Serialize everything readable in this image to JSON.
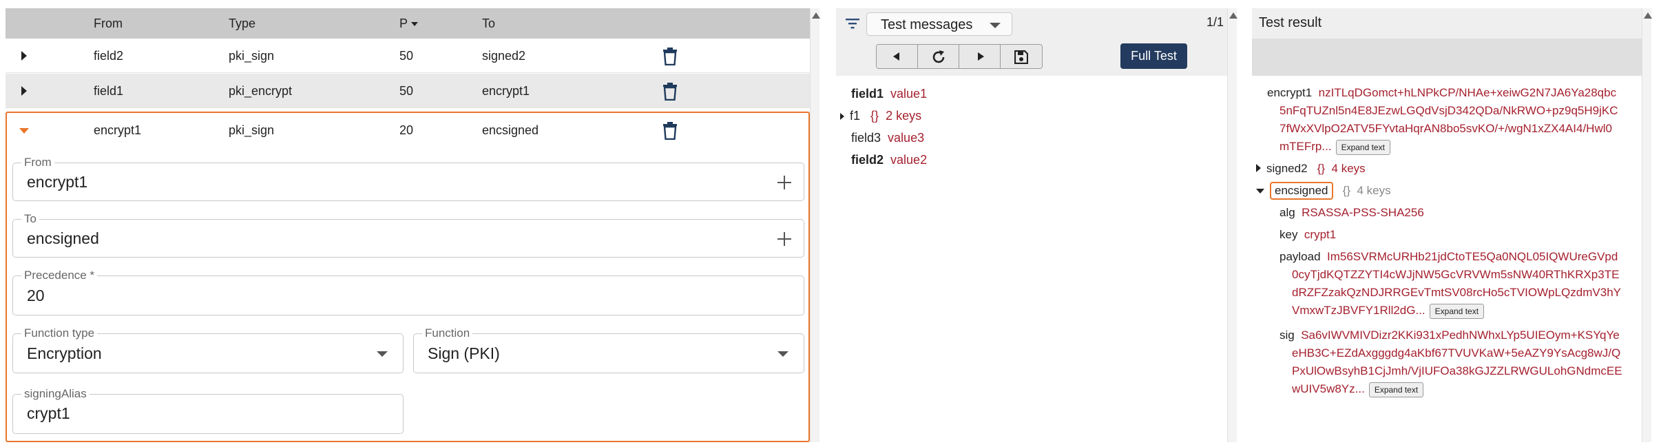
{
  "table": {
    "columns": {
      "from": "From",
      "type": "Type",
      "precedence": "P",
      "to": "To"
    },
    "rows": [
      {
        "from": "field2",
        "type": "pki_sign",
        "precedence": "50",
        "to": "signed2"
      },
      {
        "from": "field1",
        "type": "pki_encrypt",
        "precedence": "50",
        "to": "encrypt1"
      },
      {
        "from": "encrypt1",
        "type": "pki_sign",
        "precedence": "20",
        "to": "encsigned"
      }
    ]
  },
  "editor": {
    "from_label": "From",
    "from_value": "encrypt1",
    "to_label": "To",
    "to_value": "encsigned",
    "precedence_label": "Precedence *",
    "precedence_value": "20",
    "function_type_label": "Function type",
    "function_type_value": "Encryption",
    "function_label": "Function",
    "function_value": "Sign (PKI)",
    "signing_alias_label": "signingAlias",
    "signing_alias_value": "crypt1"
  },
  "messages": {
    "selector": "Test messages",
    "page": "1/1",
    "full_test": "Full Test",
    "items": [
      {
        "key": "field1",
        "value": "value1"
      },
      {
        "key": "f1",
        "braces": "{}",
        "value": "2 keys"
      },
      {
        "key": "field3",
        "value": "value3"
      },
      {
        "key": "field2",
        "value": "value2"
      }
    ]
  },
  "result": {
    "title": "Test result",
    "expand_label": "Expand text",
    "encrypt1_key": "encrypt1",
    "encrypt1_lines": [
      "nzITLqDGomct+hLNPkCP/NHAe+xeiwG2N7JA6Ya28qbc",
      "5nFqTUZnl5n4E8JEzwLGQdVsjD342QDa/NkRWO+pz9q5H9jKC",
      "7fWxXVlpO2ATV5FYvtaHqrAN8bo5svKO/+/wgN1xZX4AI4/Hwl0",
      "mTEFrp..."
    ],
    "signed2_key": "signed2",
    "signed2_braces": "{}",
    "signed2_count": "4 keys",
    "encsigned_key": "encsigned",
    "encsigned_braces": "{}",
    "encsigned_count": "4 keys",
    "alg_key": "alg",
    "alg_value": "RSASSA-PSS-SHA256",
    "keyfield_key": "key",
    "keyfield_value": "crypt1",
    "payload_key": "payload",
    "payload_lines": [
      "Im56SVRMcURHb21jdCtoTE5Qa0NQL05IQWUreGVpd",
      "0cyTjdKQTZZYTI4cWJjNW5GcVRVWm5sNW40RThKRXp3TE",
      "dRZFZzakQzNDJRRGEvTmtSV08rcHo5cTVIOWpLQzdmV3hY",
      "VmxwTzJBVFY1Rll2dG..."
    ],
    "sig_key": "sig",
    "sig_lines": [
      "Sa6vIWVMIVDizr2KKi931xPedhNWhxLYp5UIEOym+KSYqYe",
      "eHB3C+EZdAxgggdg4aKbf67TVUVKaW+5eAZY9YsAcg8wJ/Q",
      "PxUlOwBsyhB1CjJmh/VjIUFOa38kGJZZLRWGULohGNdmcEE",
      "wUIV5w8Yz..."
    ]
  }
}
